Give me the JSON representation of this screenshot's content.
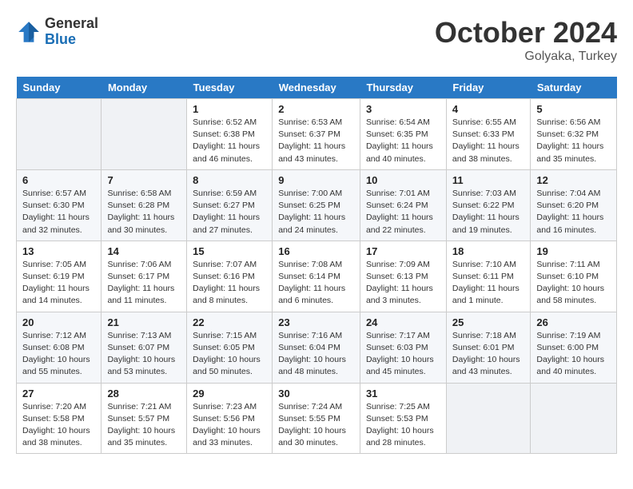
{
  "header": {
    "logo_general": "General",
    "logo_blue": "Blue",
    "month_year": "October 2024",
    "location": "Golyaka, Turkey"
  },
  "days_of_week": [
    "Sunday",
    "Monday",
    "Tuesday",
    "Wednesday",
    "Thursday",
    "Friday",
    "Saturday"
  ],
  "weeks": [
    [
      {
        "day": "",
        "empty": true
      },
      {
        "day": "",
        "empty": true
      },
      {
        "day": "1",
        "sunrise": "6:52 AM",
        "sunset": "6:38 PM",
        "daylight": "11 hours and 46 minutes."
      },
      {
        "day": "2",
        "sunrise": "6:53 AM",
        "sunset": "6:37 PM",
        "daylight": "11 hours and 43 minutes."
      },
      {
        "day": "3",
        "sunrise": "6:54 AM",
        "sunset": "6:35 PM",
        "daylight": "11 hours and 40 minutes."
      },
      {
        "day": "4",
        "sunrise": "6:55 AM",
        "sunset": "6:33 PM",
        "daylight": "11 hours and 38 minutes."
      },
      {
        "day": "5",
        "sunrise": "6:56 AM",
        "sunset": "6:32 PM",
        "daylight": "11 hours and 35 minutes."
      }
    ],
    [
      {
        "day": "6",
        "sunrise": "6:57 AM",
        "sunset": "6:30 PM",
        "daylight": "11 hours and 32 minutes."
      },
      {
        "day": "7",
        "sunrise": "6:58 AM",
        "sunset": "6:28 PM",
        "daylight": "11 hours and 30 minutes."
      },
      {
        "day": "8",
        "sunrise": "6:59 AM",
        "sunset": "6:27 PM",
        "daylight": "11 hours and 27 minutes."
      },
      {
        "day": "9",
        "sunrise": "7:00 AM",
        "sunset": "6:25 PM",
        "daylight": "11 hours and 24 minutes."
      },
      {
        "day": "10",
        "sunrise": "7:01 AM",
        "sunset": "6:24 PM",
        "daylight": "11 hours and 22 minutes."
      },
      {
        "day": "11",
        "sunrise": "7:03 AM",
        "sunset": "6:22 PM",
        "daylight": "11 hours and 19 minutes."
      },
      {
        "day": "12",
        "sunrise": "7:04 AM",
        "sunset": "6:20 PM",
        "daylight": "11 hours and 16 minutes."
      }
    ],
    [
      {
        "day": "13",
        "sunrise": "7:05 AM",
        "sunset": "6:19 PM",
        "daylight": "11 hours and 14 minutes."
      },
      {
        "day": "14",
        "sunrise": "7:06 AM",
        "sunset": "6:17 PM",
        "daylight": "11 hours and 11 minutes."
      },
      {
        "day": "15",
        "sunrise": "7:07 AM",
        "sunset": "6:16 PM",
        "daylight": "11 hours and 8 minutes."
      },
      {
        "day": "16",
        "sunrise": "7:08 AM",
        "sunset": "6:14 PM",
        "daylight": "11 hours and 6 minutes."
      },
      {
        "day": "17",
        "sunrise": "7:09 AM",
        "sunset": "6:13 PM",
        "daylight": "11 hours and 3 minutes."
      },
      {
        "day": "18",
        "sunrise": "7:10 AM",
        "sunset": "6:11 PM",
        "daylight": "11 hours and 1 minute."
      },
      {
        "day": "19",
        "sunrise": "7:11 AM",
        "sunset": "6:10 PM",
        "daylight": "10 hours and 58 minutes."
      }
    ],
    [
      {
        "day": "20",
        "sunrise": "7:12 AM",
        "sunset": "6:08 PM",
        "daylight": "10 hours and 55 minutes."
      },
      {
        "day": "21",
        "sunrise": "7:13 AM",
        "sunset": "6:07 PM",
        "daylight": "10 hours and 53 minutes."
      },
      {
        "day": "22",
        "sunrise": "7:15 AM",
        "sunset": "6:05 PM",
        "daylight": "10 hours and 50 minutes."
      },
      {
        "day": "23",
        "sunrise": "7:16 AM",
        "sunset": "6:04 PM",
        "daylight": "10 hours and 48 minutes."
      },
      {
        "day": "24",
        "sunrise": "7:17 AM",
        "sunset": "6:03 PM",
        "daylight": "10 hours and 45 minutes."
      },
      {
        "day": "25",
        "sunrise": "7:18 AM",
        "sunset": "6:01 PM",
        "daylight": "10 hours and 43 minutes."
      },
      {
        "day": "26",
        "sunrise": "7:19 AM",
        "sunset": "6:00 PM",
        "daylight": "10 hours and 40 minutes."
      }
    ],
    [
      {
        "day": "27",
        "sunrise": "7:20 AM",
        "sunset": "5:58 PM",
        "daylight": "10 hours and 38 minutes."
      },
      {
        "day": "28",
        "sunrise": "7:21 AM",
        "sunset": "5:57 PM",
        "daylight": "10 hours and 35 minutes."
      },
      {
        "day": "29",
        "sunrise": "7:23 AM",
        "sunset": "5:56 PM",
        "daylight": "10 hours and 33 minutes."
      },
      {
        "day": "30",
        "sunrise": "7:24 AM",
        "sunset": "5:55 PM",
        "daylight": "10 hours and 30 minutes."
      },
      {
        "day": "31",
        "sunrise": "7:25 AM",
        "sunset": "5:53 PM",
        "daylight": "10 hours and 28 minutes."
      },
      {
        "day": "",
        "empty": true
      },
      {
        "day": "",
        "empty": true
      }
    ]
  ],
  "labels": {
    "sunrise_prefix": "Sunrise: ",
    "sunset_prefix": "Sunset: ",
    "daylight_prefix": "Daylight: "
  }
}
